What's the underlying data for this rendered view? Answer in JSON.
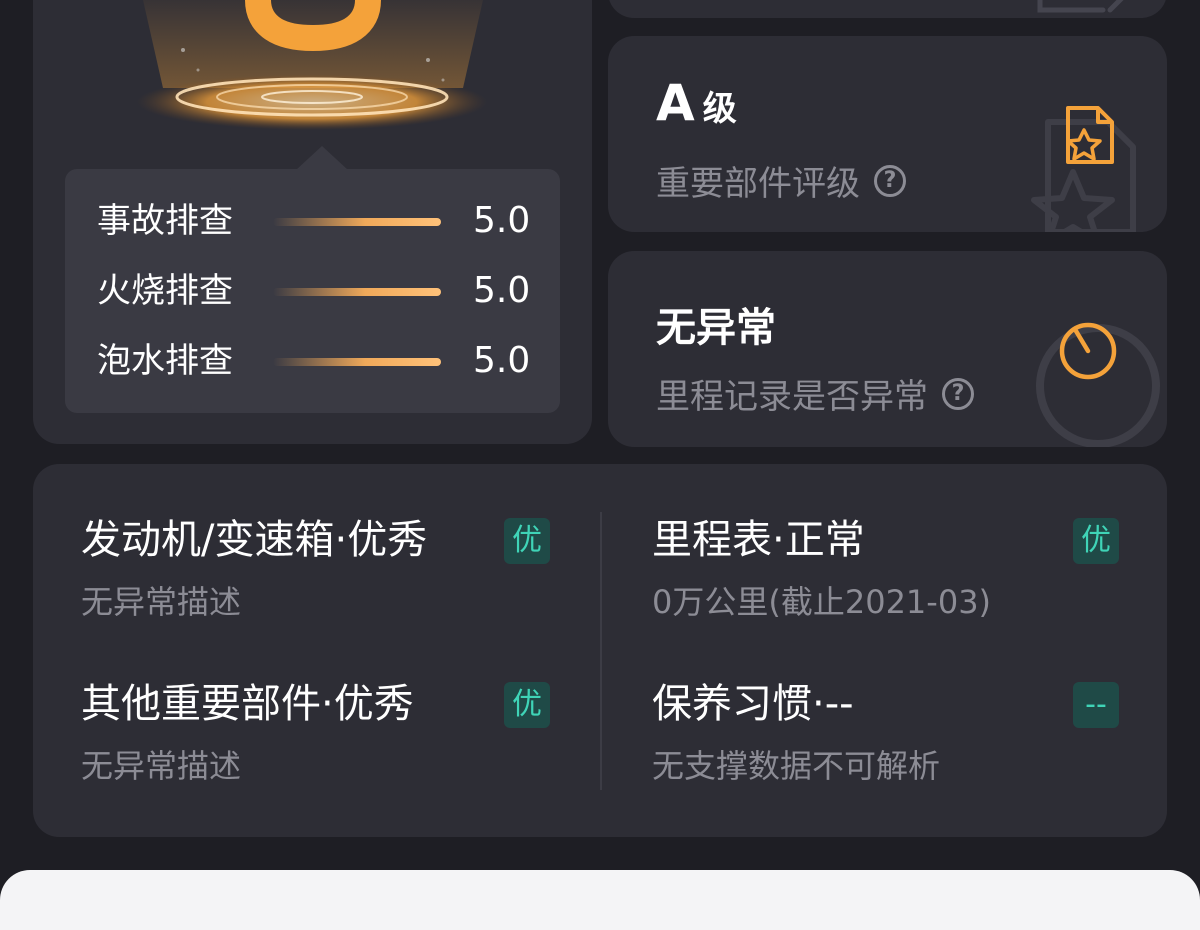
{
  "score_display": {
    "checks": [
      {
        "label": "事故排查",
        "value": "5.0",
        "fill": 1.0
      },
      {
        "label": "火烧排查",
        "value": "5.0",
        "fill": 1.0
      },
      {
        "label": "泡水排查",
        "value": "5.0",
        "fill": 1.0
      }
    ]
  },
  "grade_card": {
    "title_main": "A",
    "title_suffix": "级",
    "subtitle": "重要部件评级",
    "help_icon": "?"
  },
  "mileage_card": {
    "title": "无异常",
    "subtitle": "里程记录是否异常",
    "help_icon": "?"
  },
  "details": {
    "left": [
      {
        "title": "发动机/变速箱·优秀",
        "desc": "无异常描述",
        "badge": "优"
      },
      {
        "title": "其他重要部件·优秀",
        "desc": "无异常描述",
        "badge": "优"
      }
    ],
    "right": [
      {
        "title": "里程表·正常",
        "desc": "0万公里(截止2021-03)",
        "badge": "优"
      },
      {
        "title": "保养习惯·--",
        "desc": "无支撑数据不可解析",
        "badge": "--"
      }
    ]
  },
  "colors": {
    "background": "#1e1e24",
    "card": "#2d2d35",
    "accent_orange": "#f4a23a",
    "badge_text": "#3fd4b7",
    "badge_bg": "#1f4a47",
    "muted_text": "#8c8c95"
  },
  "icons": [
    "score-glow-pedestal",
    "document-star-icon",
    "star-outline-icon",
    "timer-icon",
    "help-icon"
  ]
}
